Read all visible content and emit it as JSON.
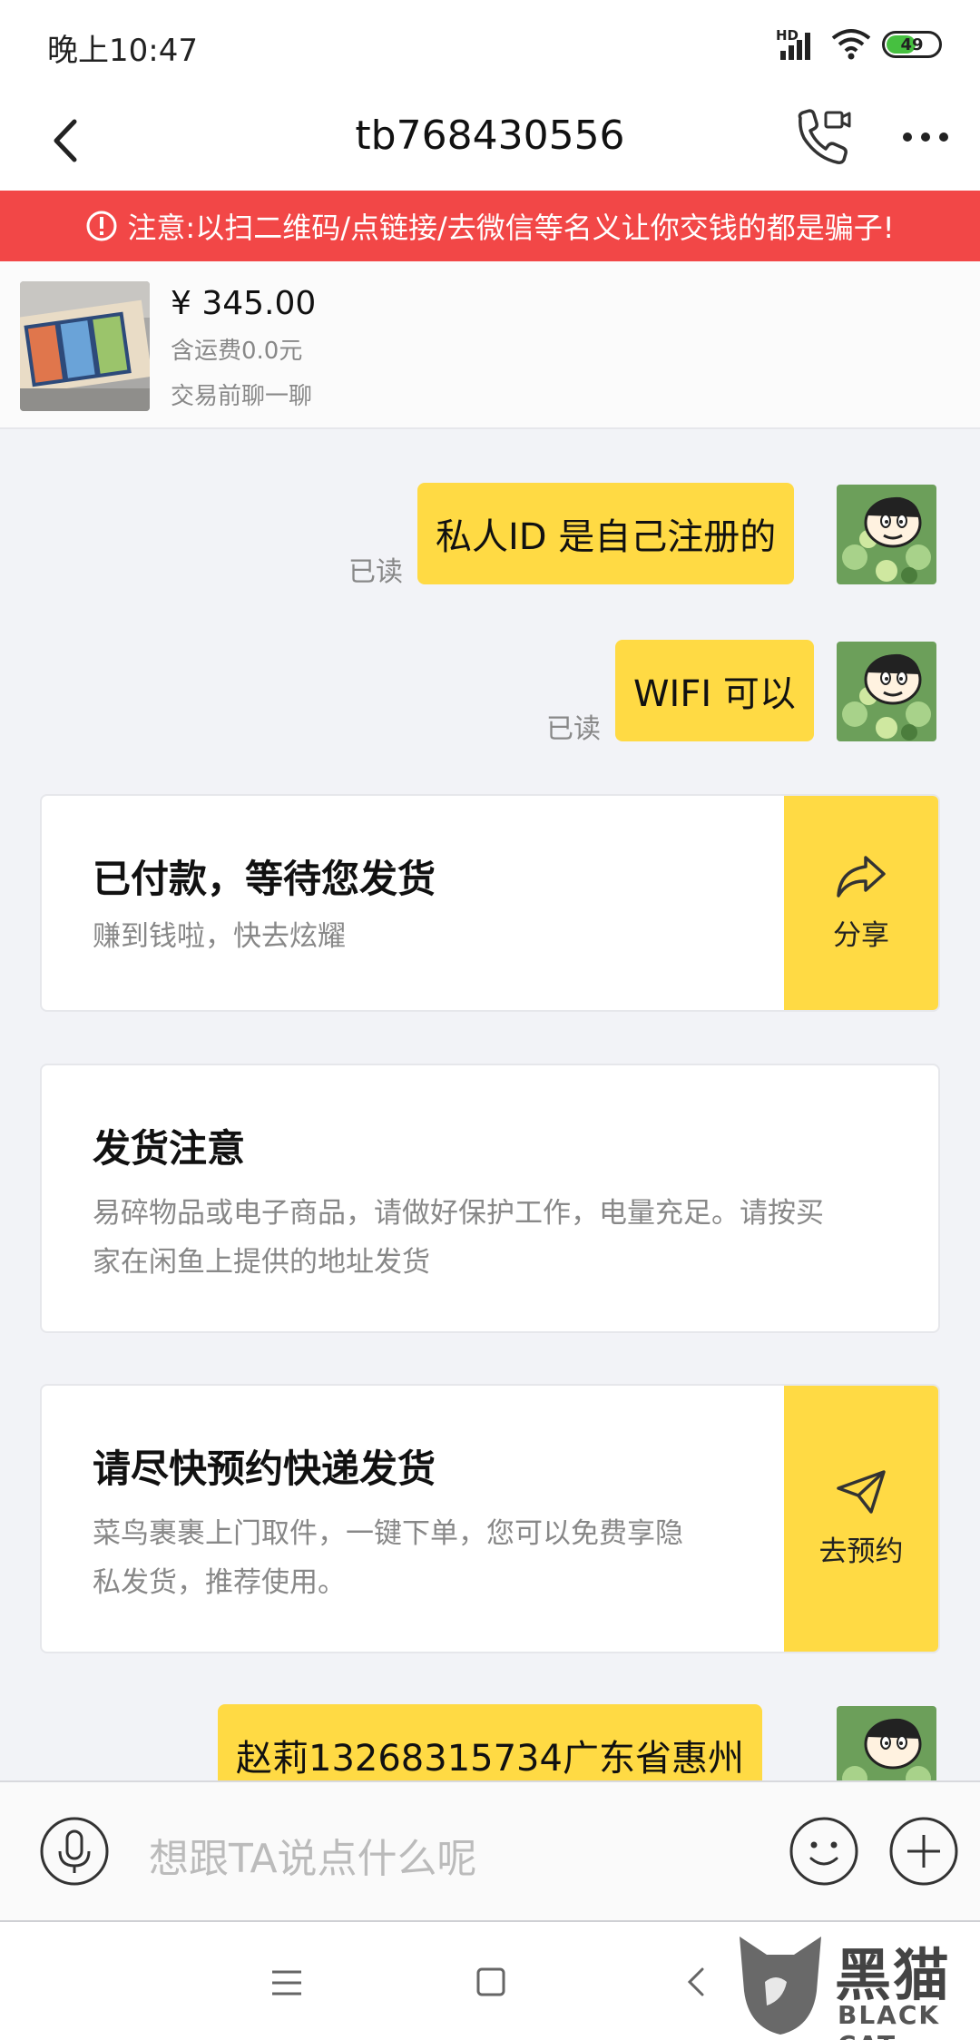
{
  "status_bar": {
    "time": "晚上10:47",
    "network_label": "HD",
    "battery": "49"
  },
  "header": {
    "back_icon": "chevron-left-icon",
    "title": "tb768430556",
    "call_icon": "phone-video-icon",
    "more_icon": "more-dots-icon"
  },
  "warning": {
    "text": "注意:以扫二维码/点链接/去微信等名义让你交钱的都是骗子!",
    "background": "#f24747"
  },
  "product": {
    "price": "¥ 345.00",
    "shipping": "含运费0.0元",
    "chat_hint": "交易前聊一聊"
  },
  "messages": [
    {
      "text": "私人ID 是自己注册的",
      "status": "已读"
    },
    {
      "text": "WIFI 可以",
      "status": "已读"
    },
    {
      "text": "赵莉13268315734广东省惠州"
    }
  ],
  "cards": [
    {
      "title": "已付款，等待您发货",
      "desc": "赚到钱啦，快去炫耀",
      "action": "分享"
    },
    {
      "title": "发货注意",
      "desc_line1": "易碎物品或电子商品，请做好保护工作，电量充足。请按买",
      "desc_line2": "家在闲鱼上提供的地址发货"
    },
    {
      "title": "请尽快预约快递发货",
      "desc_line1": "菜鸟裹裹上门取件，一键下单，您可以免费享隐",
      "desc_line2": "私发货，推荐使用。",
      "action": "去预约"
    }
  ],
  "input": {
    "placeholder": "想跟TA说点什么呢"
  },
  "watermark": {
    "main": "黑猫",
    "sub": "BLACK CAT"
  },
  "colors": {
    "accent_yellow": "#ffda44",
    "warning_red": "#f24747",
    "page_bg": "#f2f3f7"
  }
}
